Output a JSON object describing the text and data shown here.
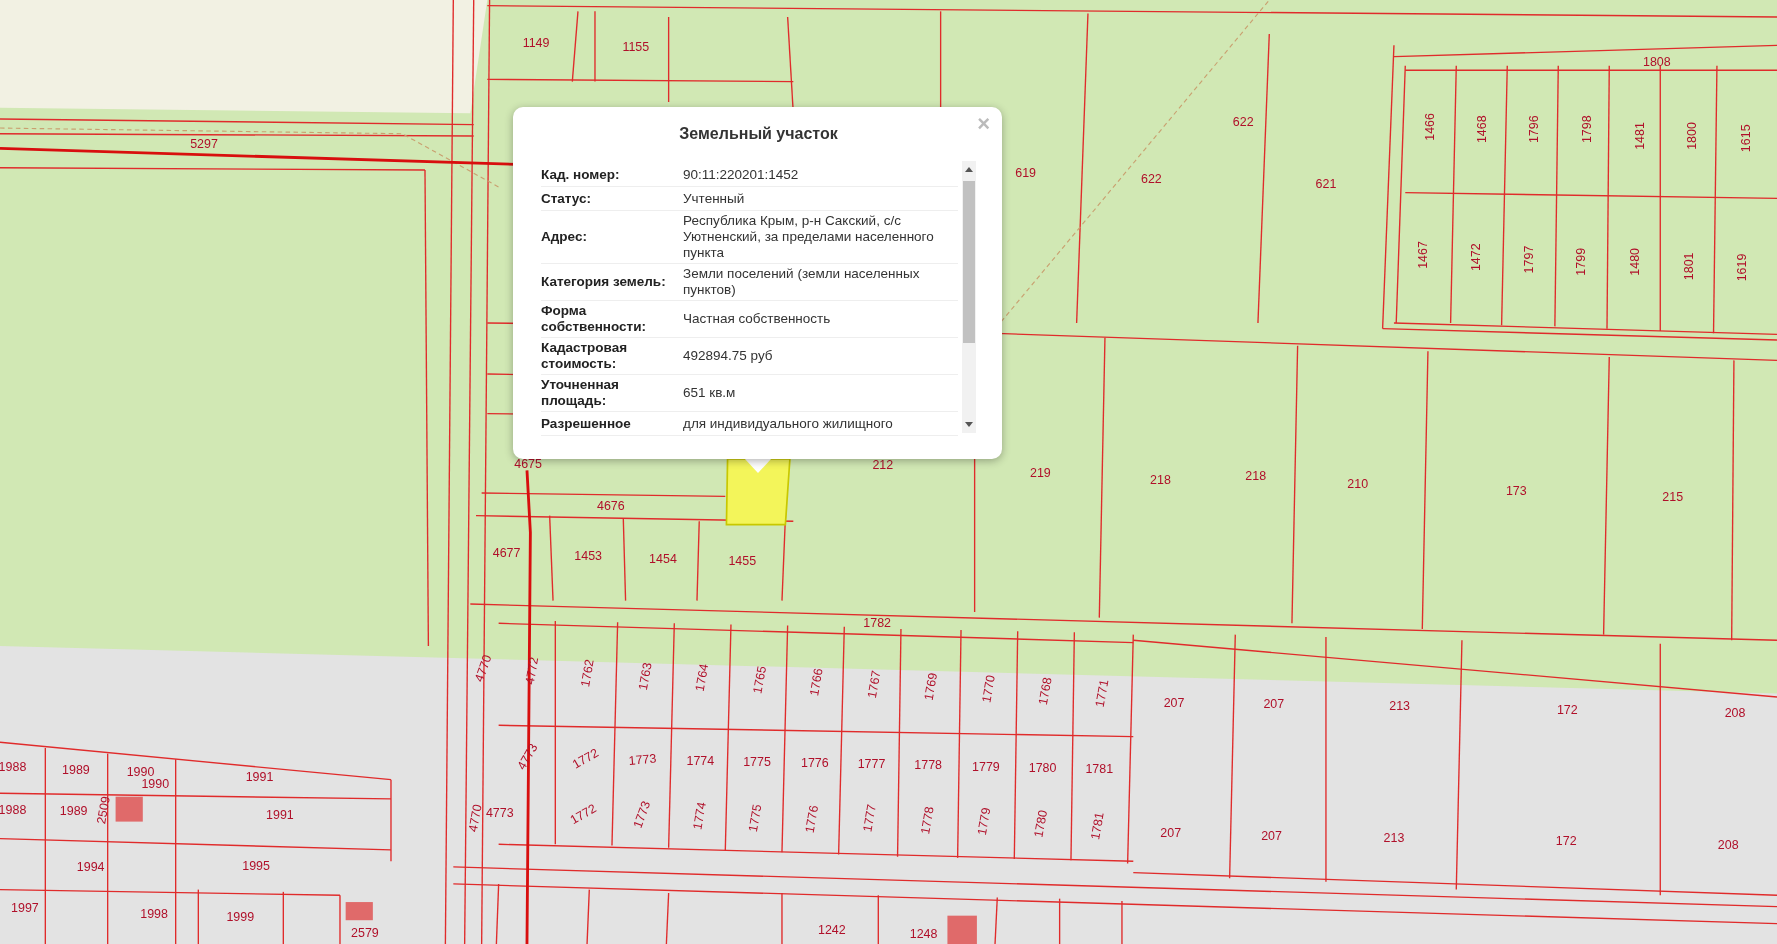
{
  "map": {
    "parcel_labels": [
      "1149",
      "1155",
      "5297",
      "622",
      "622",
      "621",
      "1808",
      "619",
      "1466",
      "1468",
      "1796",
      "1798",
      "1481",
      "1800",
      "1615",
      "1467",
      "1472",
      "1797",
      "1799",
      "1480",
      "1801",
      "1619",
      "4675",
      "212",
      "219",
      "218",
      "218",
      "210",
      "173",
      "215",
      "4676",
      "4677",
      "1453",
      "1454",
      "1455",
      "1782",
      "4770",
      "4772",
      "1762",
      "1763",
      "1764",
      "1765",
      "1766",
      "1767",
      "1769",
      "1770",
      "1768",
      "1771",
      "207",
      "207",
      "213",
      "172",
      "208",
      "1988",
      "1989",
      "1990",
      "1991",
      "4773",
      "1772",
      "1773",
      "1774",
      "1775",
      "1776",
      "1777",
      "1778",
      "1779",
      "1780",
      "1781",
      "1988",
      "1989",
      "1990",
      "1991",
      "4770",
      "4773",
      "1772",
      "1773",
      "1774",
      "1775",
      "1776",
      "1777",
      "1778",
      "1779",
      "1780",
      "1781",
      "207",
      "207",
      "213",
      "172",
      "208",
      "1994",
      "1995",
      "1997",
      "1998",
      "1999",
      "2579",
      "1242",
      "1248",
      "2509"
    ],
    "selected_parcel": {
      "selected": true
    }
  },
  "popup": {
    "title": "Земельный участок",
    "close": "×",
    "rows": [
      {
        "label": "Кад. номер:",
        "value": "90:11:220201:1452"
      },
      {
        "label": "Статус:",
        "value": "Учтенный"
      },
      {
        "label": "Адрес:",
        "value": "Республика Крым, р-н Сакский, с/с Уютненский, за пределами населенного пункта"
      },
      {
        "label": "Категория земель:",
        "value": "Земли поселений (земли населенных пунктов)"
      },
      {
        "label": "Форма собственности:",
        "value": "Частная собственность"
      },
      {
        "label": "Кадастровая стоимость:",
        "value": "492894.75 руб"
      },
      {
        "label": "Уточненная площадь:",
        "value": "651 кв.м"
      },
      {
        "label": "Разрешенное",
        "value": "для индивидуального жилищного"
      }
    ]
  }
}
